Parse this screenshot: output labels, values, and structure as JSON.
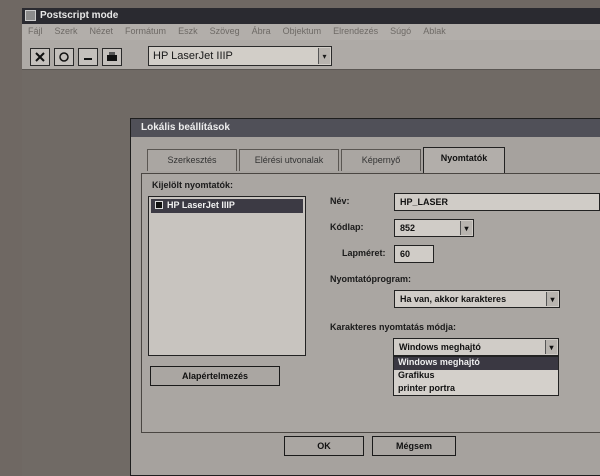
{
  "app": {
    "title": "Postscript mode",
    "menu": [
      "Fájl",
      "Szerk",
      "Nézet",
      "Formátum",
      "Eszk",
      "Szöveg",
      "Ábra",
      "Objektum",
      "Elrendezés",
      "Súgó",
      "Ablak"
    ]
  },
  "toolbar": {
    "printer_value": "HP LaserJet IIIP"
  },
  "dialog": {
    "title": "Lokális beállítások",
    "tabs": [
      {
        "label": "Szerkesztés"
      },
      {
        "label": "Elérési utvonalak"
      },
      {
        "label": "Képernyő"
      },
      {
        "label": "Nyomtatók"
      }
    ],
    "installed_label": "Kijelölt nyomtatók:",
    "installed_printers": [
      "HP LaserJet IIIP"
    ],
    "default_button": "Alapértelmezés",
    "name_label": "Név:",
    "name_value": "HP_LASER",
    "codepage_label": "Kódlap:",
    "codepage_value": "852",
    "width_label": "Lapméret:",
    "width_value": "60",
    "printer_program_label": "Nyomtatóprogram:",
    "printer_program_value": "Ha van, akkor karakteres",
    "char_mode_label": "Karakteres nyomtatás módja:",
    "char_mode_value": "Windows meghajtó",
    "char_mode_options": [
      "Windows meghajtó",
      "Grafikus",
      "printer portra"
    ],
    "ok_button": "OK",
    "cancel_button": "Mégsem"
  }
}
